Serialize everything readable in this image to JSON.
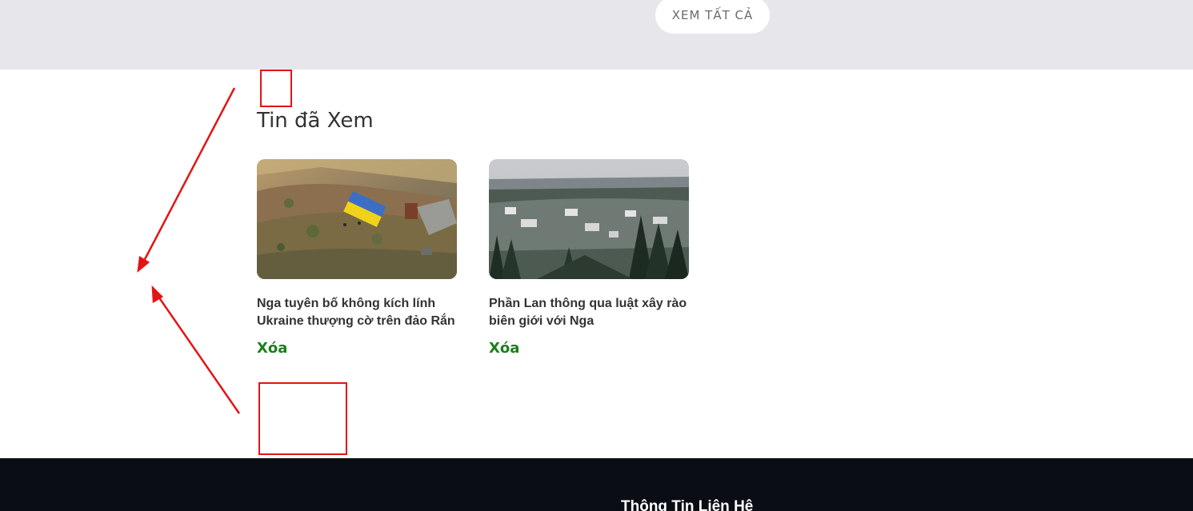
{
  "header": {
    "view_all_label": "XEM TẤT CẢ"
  },
  "viewed_news": {
    "title": "Tin đã Xem",
    "items": [
      {
        "title": "Nga tuyên bố không kích lính Ukraine thượng cờ trên đảo Rắn",
        "delete_label": "Xóa",
        "thumbnail_icon": "snake-island-aerial-image"
      },
      {
        "title": "Phần Lan thông qua luật xây rào biên giới với Nga",
        "delete_label": "Xóa",
        "thumbnail_icon": "finland-winter-town-image"
      }
    ]
  },
  "footer": {
    "contact_heading": "Thông Tin Liên Hệ"
  },
  "colors": {
    "top_band": "#e7e7eb",
    "accent_green": "#1b7f1b",
    "footer_bg": "#0a0d14",
    "annotation_red": "#e31414"
  }
}
